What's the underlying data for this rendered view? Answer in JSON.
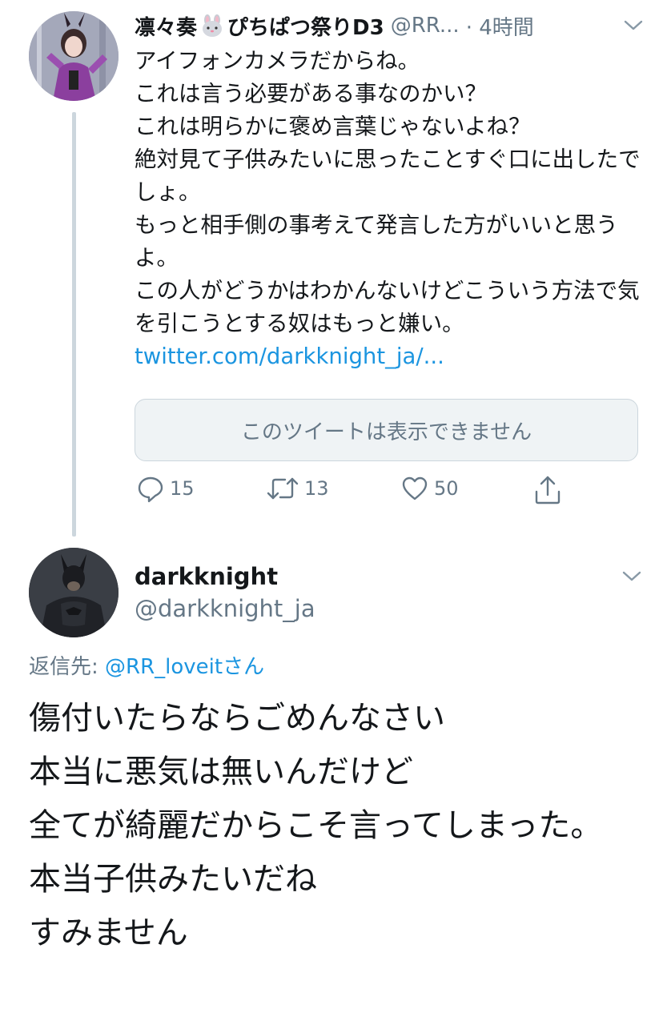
{
  "tweet1": {
    "display_name": "凛々奏",
    "name_suffix": "ぴちぱつ祭りD3",
    "handle": "@RR...",
    "time": "· 4時間",
    "text": "アイフォンカメラだからね。\nこれは言う必要がある事なのかい？\nこれは明らかに褒め言葉じゃないよね？\n絶対見て子供みたいに思ったことすぐ口に出したでしょ。\nもっと相手側の事考えて発言した方がいいと思うよ。\nこの人がどうかはわかんないけどこういう方法で気を引こうとする奴はもっと嫌い。",
    "link": "twitter.com/darkknight_ja/...",
    "quote_unavailable": "このツイートは表示できません",
    "reply_count": "15",
    "retweet_count": "13",
    "like_count": "50"
  },
  "tweet2": {
    "display_name": "darkknight",
    "handle": "@darkknight_ja",
    "reply_prefix": "返信先: ",
    "reply_mention": "@RR_loveit",
    "reply_suffix": "さん",
    "text": "傷付いたらならごめんなさい\n本当に悪気は無いんだけど\n全てが綺麗だからこそ言ってしまった。\n本当子供みたいだね\nすみません"
  },
  "colors": {
    "link_blue": "#1b95e0",
    "secondary_gray": "#657786",
    "thread_line": "#ccd6dd",
    "quote_bg": "#eff3f5"
  },
  "icons": {
    "reply": "reply-icon",
    "retweet": "retweet-icon",
    "like": "heart-icon",
    "share": "share-icon",
    "menu": "chevron-down-icon",
    "emoji": "rabbit-face-icon"
  }
}
